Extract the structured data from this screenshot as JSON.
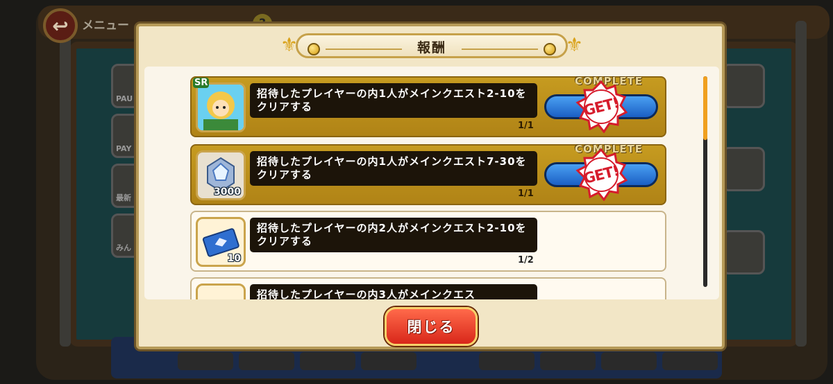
{
  "background": {
    "menu_label": "メニュー",
    "help_icon": "?",
    "side_labels": [
      "PAU",
      "PAY",
      "最新",
      "みん"
    ]
  },
  "modal": {
    "title": "報酬",
    "close_label": "閉じる"
  },
  "rewards": [
    {
      "status": "complete",
      "complete_label": "COMPLETE",
      "get_label": "GET!",
      "icon": "character-portrait-icon",
      "icon_badge": "SR",
      "quantity": "",
      "description": "招待したプレイヤーの内1人がメインクエスト2-10をクリアする",
      "progress": "1/1"
    },
    {
      "status": "complete",
      "complete_label": "COMPLETE",
      "get_label": "GET!",
      "icon": "gem-crystal-icon",
      "quantity": "3000",
      "description": "招待したプレイヤーの内1人がメインクエスト7-30をクリアする",
      "progress": "1/1"
    },
    {
      "status": "in_progress",
      "icon": "ticket-icon",
      "quantity": "10",
      "description": "招待したプレイヤーの内2人がメインクエスト2-10をクリアする",
      "progress": "1/2"
    },
    {
      "status": "in_progress",
      "icon": "ticket-icon",
      "quantity": "",
      "description": "招待したプレイヤーの内3人がメインクエス",
      "progress": ""
    }
  ],
  "colors": {
    "complete_card": "#c69b20",
    "stamp_red": "#d61c2c",
    "close_button": "#e8341e",
    "accent_gold": "#d9a21a"
  }
}
